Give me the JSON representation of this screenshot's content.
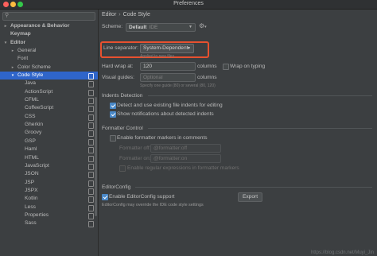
{
  "window": {
    "title": "Preferences"
  },
  "sidebar": {
    "items": [
      {
        "label": "Appearance & Behavior",
        "depth": 0,
        "arrow": "▸",
        "bold": true
      },
      {
        "label": "Keymap",
        "depth": 0,
        "arrow": "",
        "bold": true
      },
      {
        "label": "Editor",
        "depth": 0,
        "arrow": "▾",
        "bold": true
      },
      {
        "label": "General",
        "depth": 1,
        "arrow": "▸"
      },
      {
        "label": "Font",
        "depth": 1,
        "arrow": ""
      },
      {
        "label": "Color Scheme",
        "depth": 1,
        "arrow": "▸"
      },
      {
        "label": "Code Style",
        "depth": 1,
        "arrow": "▾",
        "selected": true,
        "page": true
      },
      {
        "label": "Java",
        "depth": 2,
        "page": true
      },
      {
        "label": "ActionScript",
        "depth": 2,
        "page": true
      },
      {
        "label": "CFML",
        "depth": 2,
        "page": true
      },
      {
        "label": "CoffeeScript",
        "depth": 2,
        "page": true
      },
      {
        "label": "CSS",
        "depth": 2,
        "page": true
      },
      {
        "label": "Gherkin",
        "depth": 2,
        "page": true
      },
      {
        "label": "Groovy",
        "depth": 2,
        "page": true
      },
      {
        "label": "GSP",
        "depth": 2,
        "page": true
      },
      {
        "label": "Haml",
        "depth": 2,
        "page": true
      },
      {
        "label": "HTML",
        "depth": 2,
        "page": true
      },
      {
        "label": "JavaScript",
        "depth": 2,
        "page": true
      },
      {
        "label": "JSON",
        "depth": 2,
        "page": true
      },
      {
        "label": "JSP",
        "depth": 2,
        "page": true
      },
      {
        "label": "JSPX",
        "depth": 2,
        "page": true
      },
      {
        "label": "Kotlin",
        "depth": 2,
        "page": true
      },
      {
        "label": "Less",
        "depth": 2,
        "page": true
      },
      {
        "label": "Properties",
        "depth": 2,
        "page": true
      },
      {
        "label": "Sass",
        "depth": 2,
        "page": true
      }
    ]
  },
  "breadcrumb": {
    "parent": "Editor",
    "separator": "›",
    "current": "Code Style"
  },
  "scheme": {
    "label": "Scheme:",
    "name": "Default",
    "kind": "IDE"
  },
  "general": {
    "line_separator_label": "Line separator:",
    "line_separator_value": "System-Dependent",
    "line_separator_hint": "Applied to new files",
    "hard_wrap_label": "Hard wrap at:",
    "hard_wrap_value": "120",
    "hard_wrap_unit": "columns",
    "wrap_on_typing_label": "Wrap on typing",
    "visual_guides_label": "Visual guides:",
    "visual_guides_placeholder": "Optional",
    "visual_guides_unit": "columns",
    "visual_guides_hint": "Specify one guide (80) or several (80, 120)"
  },
  "indents": {
    "title": "Indents Detection",
    "detect_label": "Detect and use existing file indents for editing",
    "notify_label": "Show notifications about detected indents"
  },
  "formatter": {
    "title": "Formatter Control",
    "enable_markers_label": "Enable formatter markers in comments",
    "off_label": "Formatter off:",
    "off_value": "@formatter:off",
    "on_label": "Formatter on:",
    "on_value": "@formatter:on",
    "regex_label": "Enable regular expressions in formatter markers"
  },
  "editorconfig": {
    "title": "EditorConfig",
    "enable_label": "Enable EditorConfig support",
    "export_label": "Export",
    "note": "EditorConfig may override the IDE code style settings"
  },
  "watermark": "https://blog.csdn.net/Muyi_Jin",
  "colors": {
    "accent": "#2f65ca",
    "highlight_box": "#e8512f",
    "background": "#3c3f41"
  }
}
